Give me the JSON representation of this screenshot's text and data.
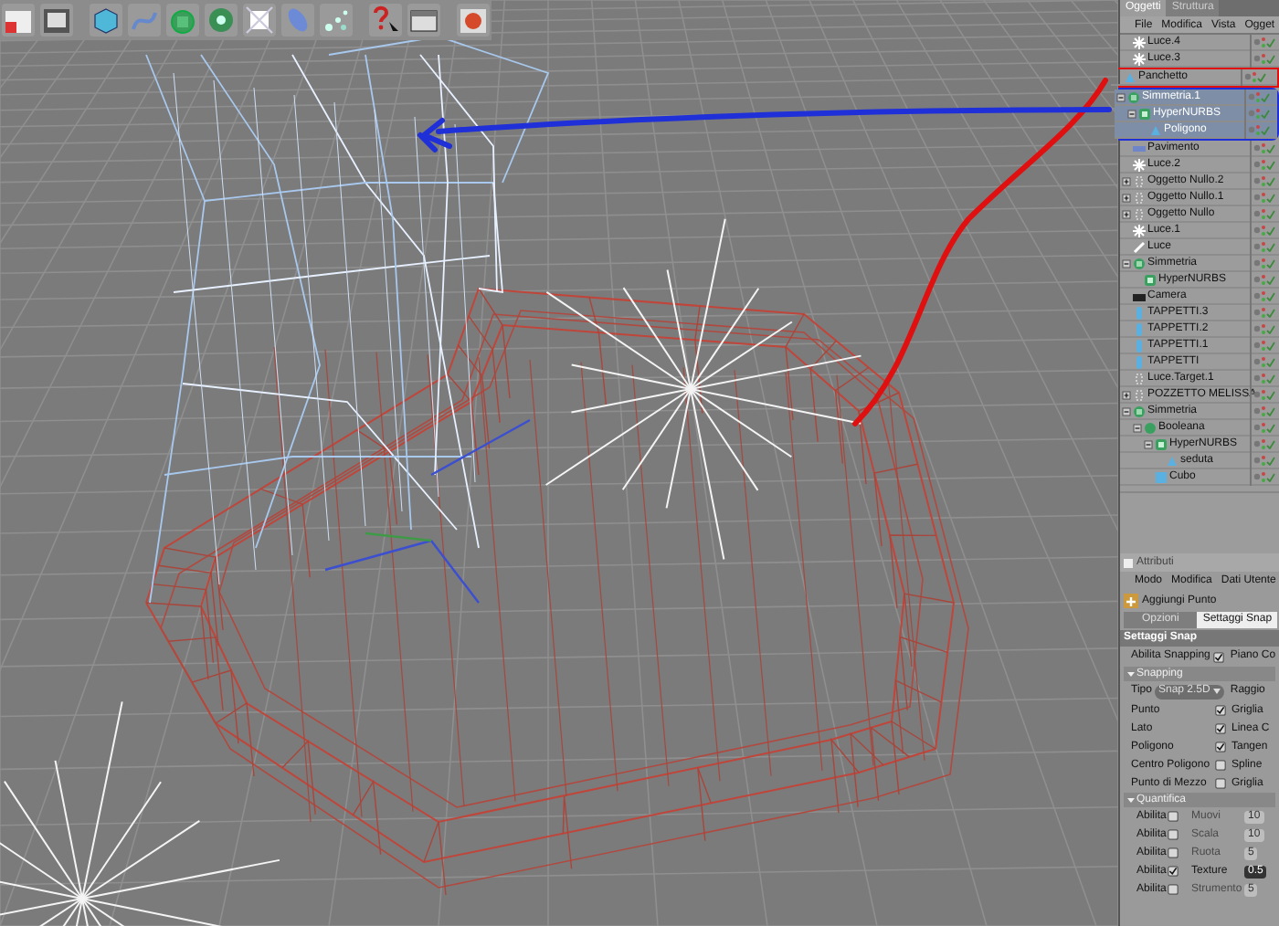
{
  "objects_panel": {
    "tabs": [
      {
        "label": "Oggetti",
        "selected": true
      },
      {
        "label": "Struttura",
        "selected": false
      }
    ],
    "menu": [
      "File",
      "Modifica",
      "Vista",
      "Ogget"
    ],
    "tree": [
      {
        "name": "Luce.4",
        "kind": "light",
        "selected": false
      },
      {
        "name": "Luce.3",
        "kind": "light",
        "selected": false
      },
      {
        "name": "Panchetto",
        "kind": "poly",
        "selected": false
      },
      {
        "name": "Simmetria.1",
        "kind": "symmetry",
        "selected": true,
        "expanded": true,
        "children": [
          {
            "name": "HyperNURBS",
            "kind": "nurbs",
            "selected": true,
            "expanded": true,
            "children": [
              {
                "name": "Poligono",
                "kind": "poly",
                "selected": true
              }
            ]
          }
        ]
      },
      {
        "name": "Pavimento",
        "kind": "floor",
        "selected": false
      },
      {
        "name": "Luce.2",
        "kind": "light",
        "selected": false
      },
      {
        "name": "Oggetto Nullo.2",
        "kind": "null",
        "selected": false,
        "expanded": false
      },
      {
        "name": "Oggetto Nullo.1",
        "kind": "null",
        "selected": false,
        "expanded": false
      },
      {
        "name": "Oggetto Nullo",
        "kind": "null",
        "selected": false,
        "expanded": false
      },
      {
        "name": "Luce.1",
        "kind": "light",
        "selected": false
      },
      {
        "name": "Luce",
        "kind": "spot",
        "selected": false
      },
      {
        "name": "Simmetria",
        "kind": "symmetry",
        "selected": false,
        "expanded": true,
        "children": [
          {
            "name": "HyperNURBS",
            "kind": "nurbs",
            "selected": false
          }
        ]
      },
      {
        "name": "Camera",
        "kind": "camera",
        "selected": false
      },
      {
        "name": "TAPPETTI.3",
        "kind": "capsule",
        "selected": false
      },
      {
        "name": "TAPPETTI.2",
        "kind": "capsule",
        "selected": false
      },
      {
        "name": "TAPPETTI.1",
        "kind": "capsule",
        "selected": false
      },
      {
        "name": "TAPPETTI",
        "kind": "capsule",
        "selected": false
      },
      {
        "name": "Luce.Target.1",
        "kind": "null",
        "selected": false
      },
      {
        "name": "POZZETTO MELISSA",
        "kind": "null",
        "selected": false,
        "expanded": false
      },
      {
        "name": "Simmetria",
        "kind": "symmetry",
        "selected": false,
        "expanded": true,
        "children": [
          {
            "name": "Booleana",
            "kind": "boolean",
            "selected": false,
            "expanded": true,
            "children": [
              {
                "name": "HyperNURBS",
                "kind": "nurbs",
                "selected": false,
                "expanded": true,
                "children": [
                  {
                    "name": "seduta",
                    "kind": "poly",
                    "selected": false
                  }
                ]
              },
              {
                "name": "Cubo",
                "kind": "cube",
                "selected": false
              }
            ]
          }
        ]
      }
    ]
  },
  "attributes_panel": {
    "title": "Attributi",
    "menu": [
      "Modo",
      "Modifica",
      "Dati Utente"
    ],
    "tool": "Aggiungi Punto",
    "tabs": [
      {
        "label": "Opzioni",
        "selected": false
      },
      {
        "label": "Settaggi Snap",
        "selected": true
      }
    ],
    "section": "Settaggi Snap",
    "enable": {
      "label": "Abilita Snapping",
      "checked": true,
      "side_label": "Piano Co"
    },
    "snapping": {
      "title": "Snapping",
      "type_label": "Tipo",
      "type_value": "Snap 2.5D",
      "type_side": "Raggio",
      "options": [
        {
          "label": "Punto",
          "checked": true,
          "side_label": "Griglia"
        },
        {
          "label": "Lato",
          "checked": true,
          "side_label": "Linea C"
        },
        {
          "label": "Poligono",
          "checked": true,
          "side_label": "Tangen"
        },
        {
          "label": "Centro Poligono",
          "checked": false,
          "side_label": "Spline"
        },
        {
          "label": "Punto di Mezzo",
          "checked": false,
          "side_label": "Griglia"
        }
      ]
    },
    "quantize": {
      "title": "Quantifica",
      "rows": [
        {
          "label": "Abilita",
          "checked": false,
          "param": "Muovi",
          "value": "10"
        },
        {
          "label": "Abilita",
          "checked": false,
          "param": "Scala",
          "value": "10"
        },
        {
          "label": "Abilita",
          "checked": false,
          "param": "Ruota",
          "value": "5"
        },
        {
          "label": "Abilita",
          "checked": true,
          "param": "Texture",
          "value": "0.5"
        },
        {
          "label": "Abilita",
          "checked": false,
          "param": "Strumento",
          "value": "5"
        }
      ]
    }
  }
}
